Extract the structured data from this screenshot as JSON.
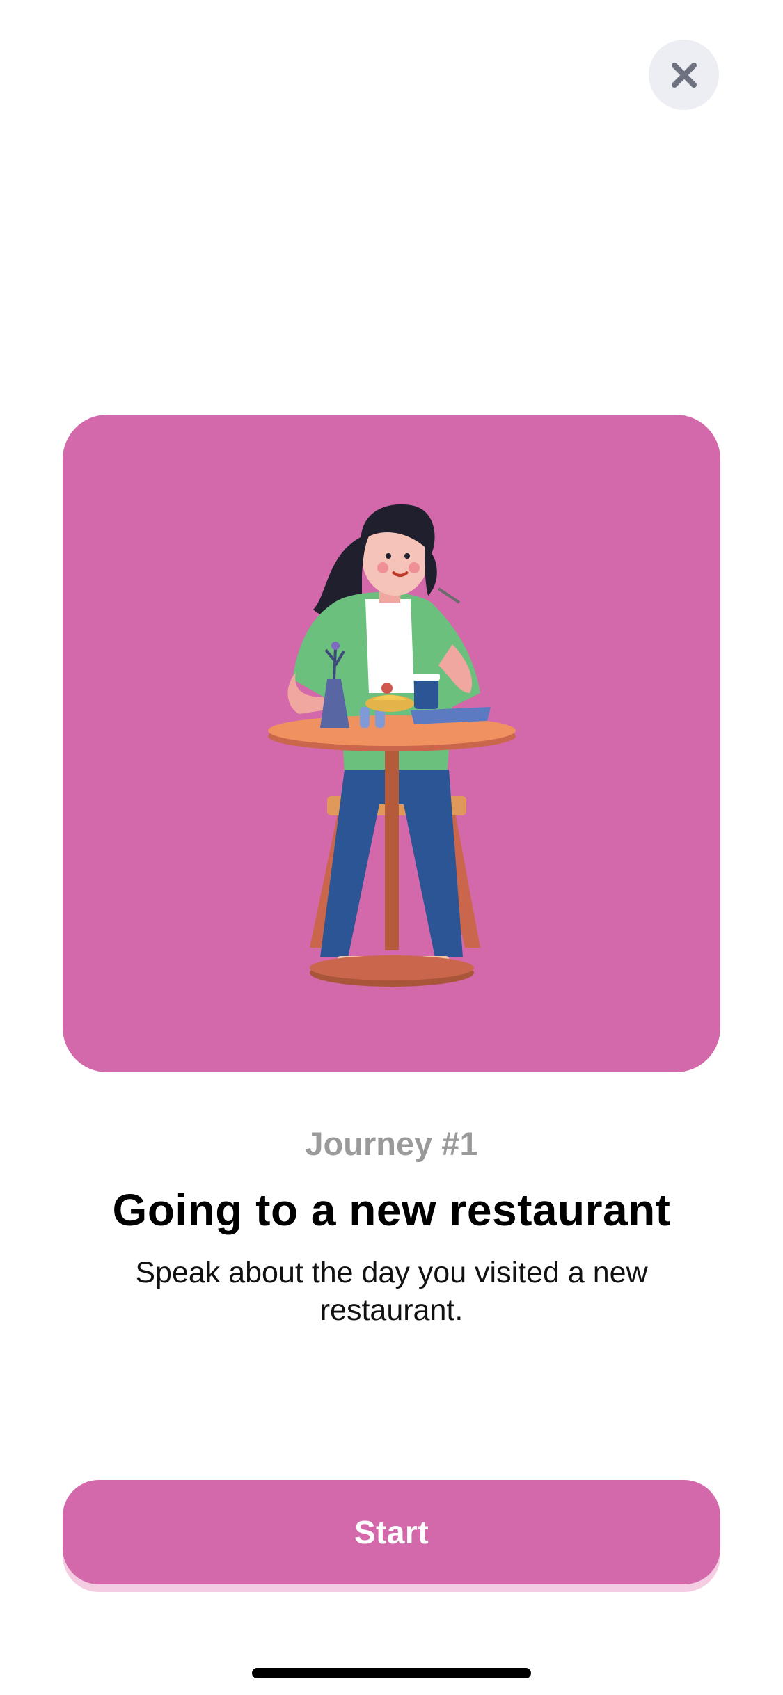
{
  "colors": {
    "accent": "#d369aa",
    "close_bg": "#eceef3",
    "close_icon": "#6e7280",
    "subtitle": "#9a9a9a"
  },
  "close_button": {
    "icon": "close-icon"
  },
  "illustration": {
    "icon": "woman-eating-at-restaurant-table-illustration"
  },
  "content": {
    "journey_label": "Journey #1",
    "title": "Going to a new restaurant",
    "description": "Speak about the day you visited a new restaurant."
  },
  "start_button": {
    "label": "Start"
  }
}
